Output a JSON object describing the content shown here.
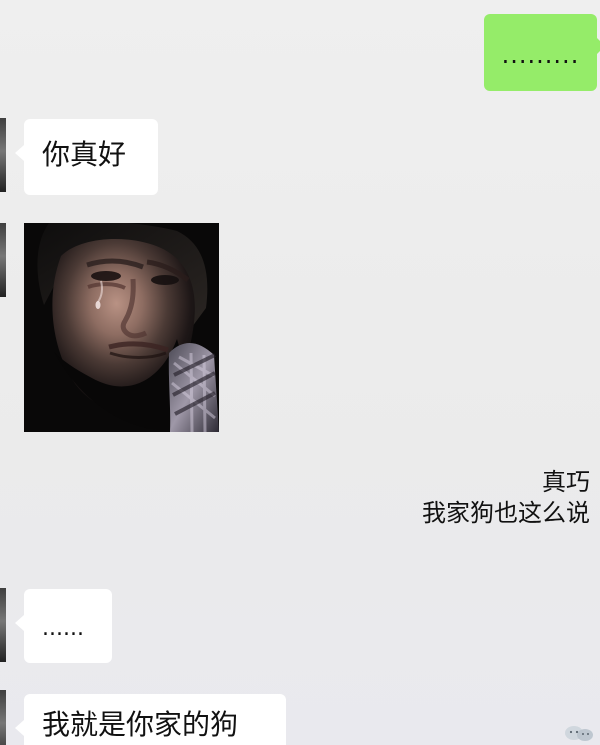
{
  "messages": [
    {
      "sender": "me",
      "text": "........."
    },
    {
      "sender": "other",
      "text": "你真好"
    },
    {
      "sender": "other",
      "image": "crying-man-meme"
    },
    {
      "sender": "me",
      "line1": "真巧",
      "line2": "我家狗也这么说"
    },
    {
      "sender": "other",
      "text": "......"
    },
    {
      "sender": "other",
      "text": "我就是你家的狗"
    }
  ],
  "colors": {
    "background": "#ececec",
    "right_bubble": "#95ec69",
    "left_bubble": "#ffffff"
  },
  "icons": {
    "watermark": "wechat-logo-icon"
  }
}
